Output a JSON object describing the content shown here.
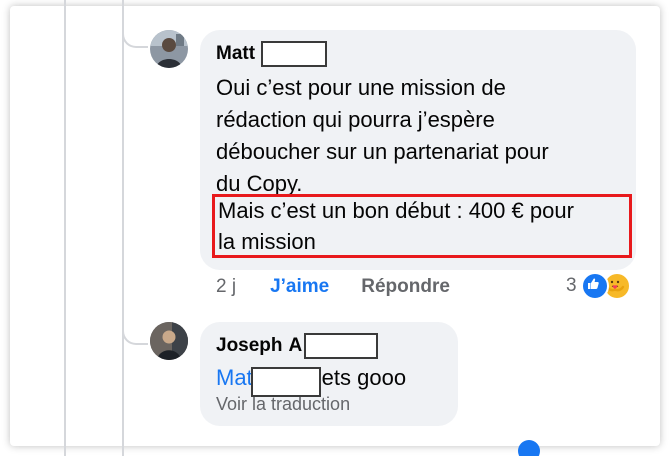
{
  "comment1": {
    "author": "Matt",
    "lines": [
      "Oui c’est pour une mission de",
      "rédaction qui pourra j’espère",
      "déboucher sur un partenariat pour",
      "du Copy."
    ],
    "highlight_lines": [
      "Mais c’est un bon début : 400 € pour",
      "la mission"
    ],
    "time": "2 j",
    "like_label": "J’aime",
    "reply_label": "Répondre",
    "reaction_count": "3",
    "highlight_color": "#e8191c"
  },
  "comment2": {
    "author": "Joseph",
    "author_initial": "A",
    "mention": "Matt",
    "message": "lets gooo",
    "translate_label": "Voir la traduction"
  },
  "colors": {
    "bubble": "#f0f2f5",
    "link": "#1877f2",
    "meta": "#65676b"
  },
  "icons": {
    "like_reaction": "thumbs-up-icon",
    "care_reaction": "care-hug-icon"
  }
}
